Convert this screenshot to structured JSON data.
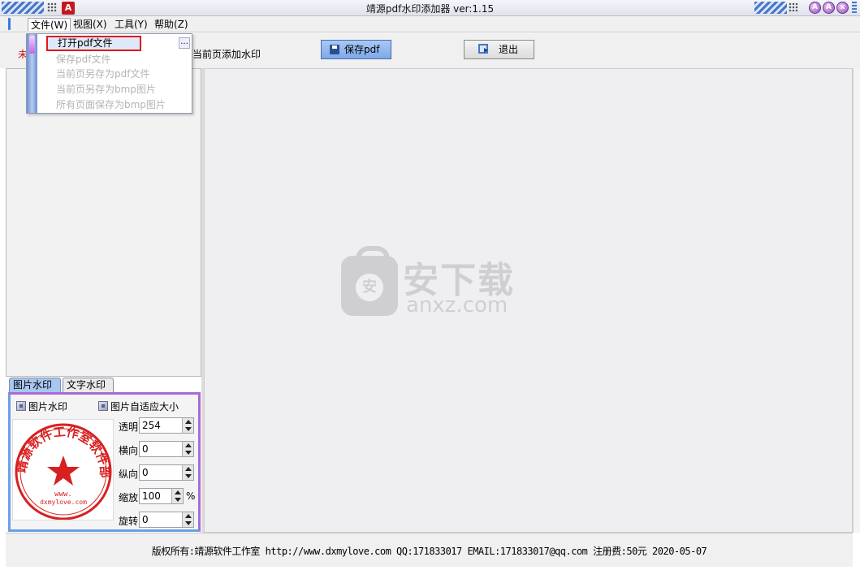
{
  "window": {
    "title": "靖源pdf水印添加器 ver:1.15",
    "logo_letter": "A",
    "min_glyph": "A",
    "max_glyph": "A",
    "close_glyph": "x"
  },
  "menubar": {
    "items": [
      {
        "label": "文件(W)"
      },
      {
        "label": "视图(X)"
      },
      {
        "label": "工具(Y)"
      },
      {
        "label": "帮助(Z)"
      }
    ]
  },
  "file_menu": {
    "items": [
      {
        "label": "打开pdf文件",
        "enabled": true,
        "selected": true
      },
      {
        "label": "保存pdf文件",
        "enabled": false
      },
      {
        "label": "当前页另存为pdf文件",
        "enabled": false
      },
      {
        "label": "当前页另存为bmp图片",
        "enabled": false
      },
      {
        "label": "所有页面保存为bmp图片",
        "enabled": false
      }
    ],
    "more_glyph": "..."
  },
  "toolbar": {
    "red_label": "未",
    "add_current_label": "当前页添加水印",
    "save_pdf_label": "保存pdf",
    "exit_label": "退出"
  },
  "tabs": {
    "image_watermark": "图片水印",
    "text_watermark": "文字水印"
  },
  "image_panel": {
    "enable_label": "图片水印",
    "autofit_label": "图片自适应大小",
    "stamp_text_top": "靖源软件工作室软件部",
    "stamp_url": "www.",
    "stamp_domain": "dxmylove.com",
    "fields": [
      {
        "label": "透明",
        "value": "254"
      },
      {
        "label": "横向",
        "value": "0"
      },
      {
        "label": "纵向",
        "value": "0"
      },
      {
        "label": "缩放",
        "value": "100",
        "suffix": "%"
      },
      {
        "label": "旋转",
        "value": "0"
      }
    ]
  },
  "canvas": {
    "watermark_cn": "安下载",
    "watermark_en": "anxz.com",
    "watermark_badge": "安"
  },
  "status": {
    "text": "版权所有:靖源软件工作室 http://www.dxmylove.com QQ:171833017 EMAIL:171833017@qq.com 注册费:50元 2020-05-07"
  },
  "colors": {
    "accent_blue": "#7ea9ea",
    "highlight_red": "#e01818",
    "panel_purple": "#a86ad6",
    "stamp_red": "#d82020"
  }
}
